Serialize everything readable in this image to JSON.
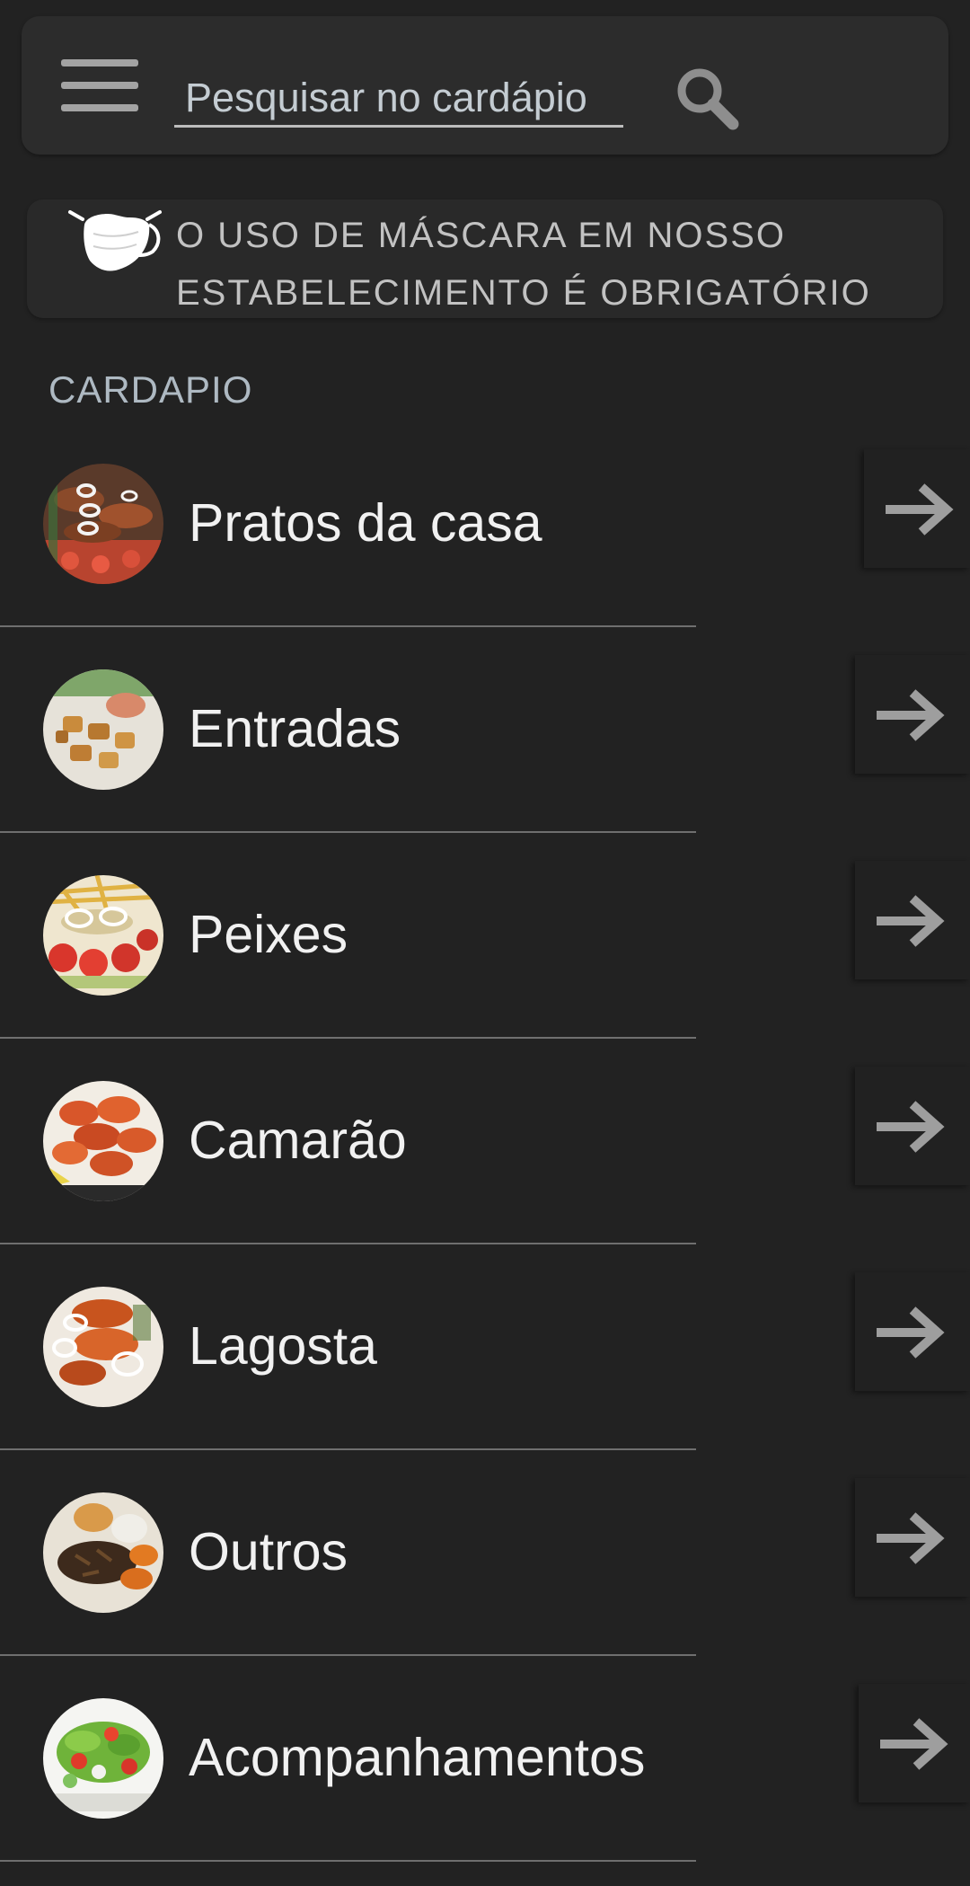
{
  "search": {
    "placeholder": "Pesquisar no cardápio",
    "value": ""
  },
  "icons": {
    "menu": "hamburger-menu-icon",
    "search": "search-icon",
    "notice": "face-mask-icon",
    "item_arrow": "arrow-right-icon"
  },
  "notice": {
    "text": "O USO DE MÁSCARA EM NOSSO ESTABELECIMENTO É OBRIGATÓRIO"
  },
  "menu": {
    "section_title": "CARDAPIO",
    "items": [
      {
        "label": "Pratos da casa"
      },
      {
        "label": "Entradas"
      },
      {
        "label": "Peixes"
      },
      {
        "label": "Camarão"
      },
      {
        "label": "Lagosta"
      },
      {
        "label": "Outros"
      },
      {
        "label": "Acompanhamentos"
      }
    ]
  },
  "colors": {
    "background": "#222222",
    "card": "#2c2c2c",
    "text": "#f1f1f1",
    "muted": "#aeb9c2",
    "arrow": "#9e9e9e"
  }
}
